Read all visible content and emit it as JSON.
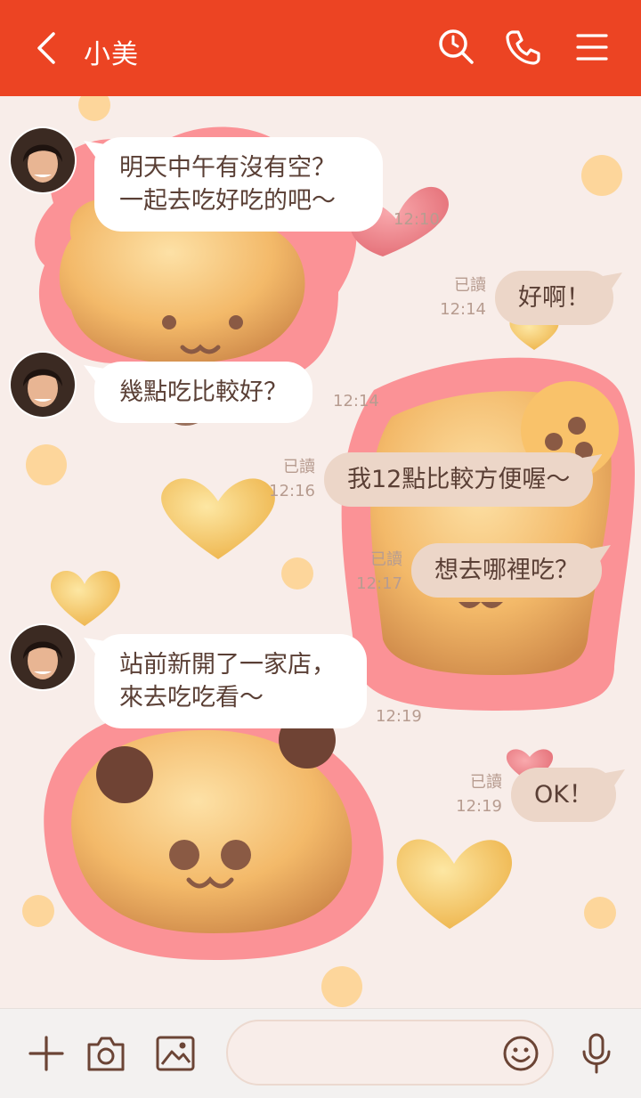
{
  "header": {
    "title": "小美"
  },
  "messages": [
    {
      "side": "left",
      "lines": [
        "明天中午有沒有空？",
        "一起去吃好吃的吧～"
      ],
      "time": "12:10"
    },
    {
      "side": "right",
      "text": "好啊！",
      "read": "已讀",
      "time": "12:14"
    },
    {
      "side": "left",
      "text": "幾點吃比較好？",
      "time": "12:14"
    },
    {
      "side": "right",
      "text": "我12點比較方便喔～",
      "read": "已讀",
      "time": "12:16"
    },
    {
      "side": "right",
      "text": "想去哪裡吃？",
      "read": "已讀",
      "time": "12:17"
    },
    {
      "side": "left",
      "lines": [
        "站前新開了一家店，",
        "來去吃吃看～"
      ],
      "time": "12:19"
    },
    {
      "side": "right",
      "text": "OK！",
      "read": "已讀",
      "time": "12:19"
    }
  ],
  "composer": {
    "placeholder": ""
  },
  "colors": {
    "header": "#ec4423",
    "background": "#f8ede9",
    "bubble_right": "#ecd6c8",
    "text": "#5a3f35"
  }
}
